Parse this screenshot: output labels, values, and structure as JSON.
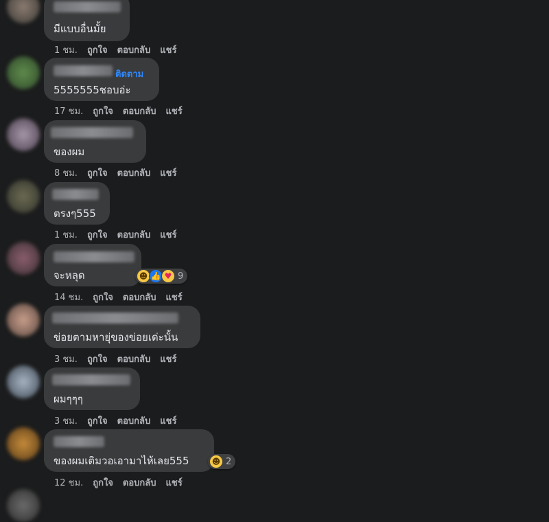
{
  "comments": [
    {
      "text": "มีแบบอื่นมั้ย",
      "time": "1 ชม."
    },
    {
      "text": "5555555ชอบอ่ะ",
      "time": "17 ชม.",
      "follow": "ติดตาม"
    },
    {
      "text": "ของผม",
      "time": "8 ชม."
    },
    {
      "text": "ตรงๆ555",
      "time": "1 ชม."
    },
    {
      "text": "จะหลุด",
      "time": "14 ชม.",
      "reaction_count": "9"
    },
    {
      "text": "ข่อยตามหายุ่ของข่อยเด่ะนั้น",
      "time": "3 ชม."
    },
    {
      "text": "ผมๆๆๆ",
      "time": "3 ชม."
    },
    {
      "text": "ของผมเติมวอเอามาไห้เลย555",
      "time": "12 ชม.",
      "reaction_count": "2"
    }
  ],
  "actions": {
    "like": "ถูกใจ",
    "reply": "ตอบกลับ",
    "share": "แชร์"
  }
}
